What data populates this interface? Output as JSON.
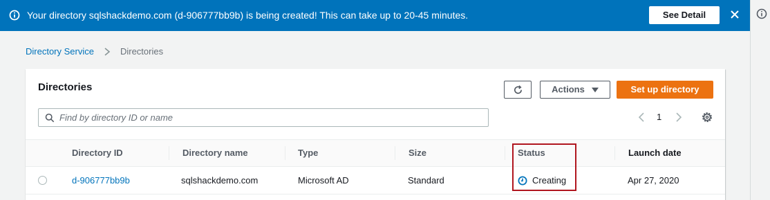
{
  "flash": {
    "message": "Your directory sqlshackdemo.com (d-906777bb9b) is being created! This can take up to 20-45 minutes.",
    "detail_label": "See Detail"
  },
  "breadcrumb": {
    "root": "Directory Service",
    "current": "Directories"
  },
  "panel": {
    "title": "Directories",
    "actions_label": "Actions",
    "setup_label": "Set up directory",
    "search_placeholder": "Find by directory ID or name",
    "page": "1"
  },
  "table": {
    "columns": [
      "Directory ID",
      "Directory name",
      "Type",
      "Size",
      "Status",
      "Launch date"
    ],
    "rows": [
      {
        "id": "d-906777bb9b",
        "name": "sqlshackdemo.com",
        "type": "Microsoft AD",
        "size": "Standard",
        "status": "Creating",
        "launch_date": "Apr 27, 2020"
      }
    ]
  },
  "colors": {
    "banner": "#0073bb",
    "primary": "#ec7211",
    "link": "#0073bb",
    "highlight": "#b0151e"
  },
  "icons": {
    "banner_info": "info-icon",
    "banner_close": "close-icon",
    "refresh": "refresh-icon",
    "search": "search-icon",
    "settings": "gear-icon",
    "status": "clock-icon"
  }
}
